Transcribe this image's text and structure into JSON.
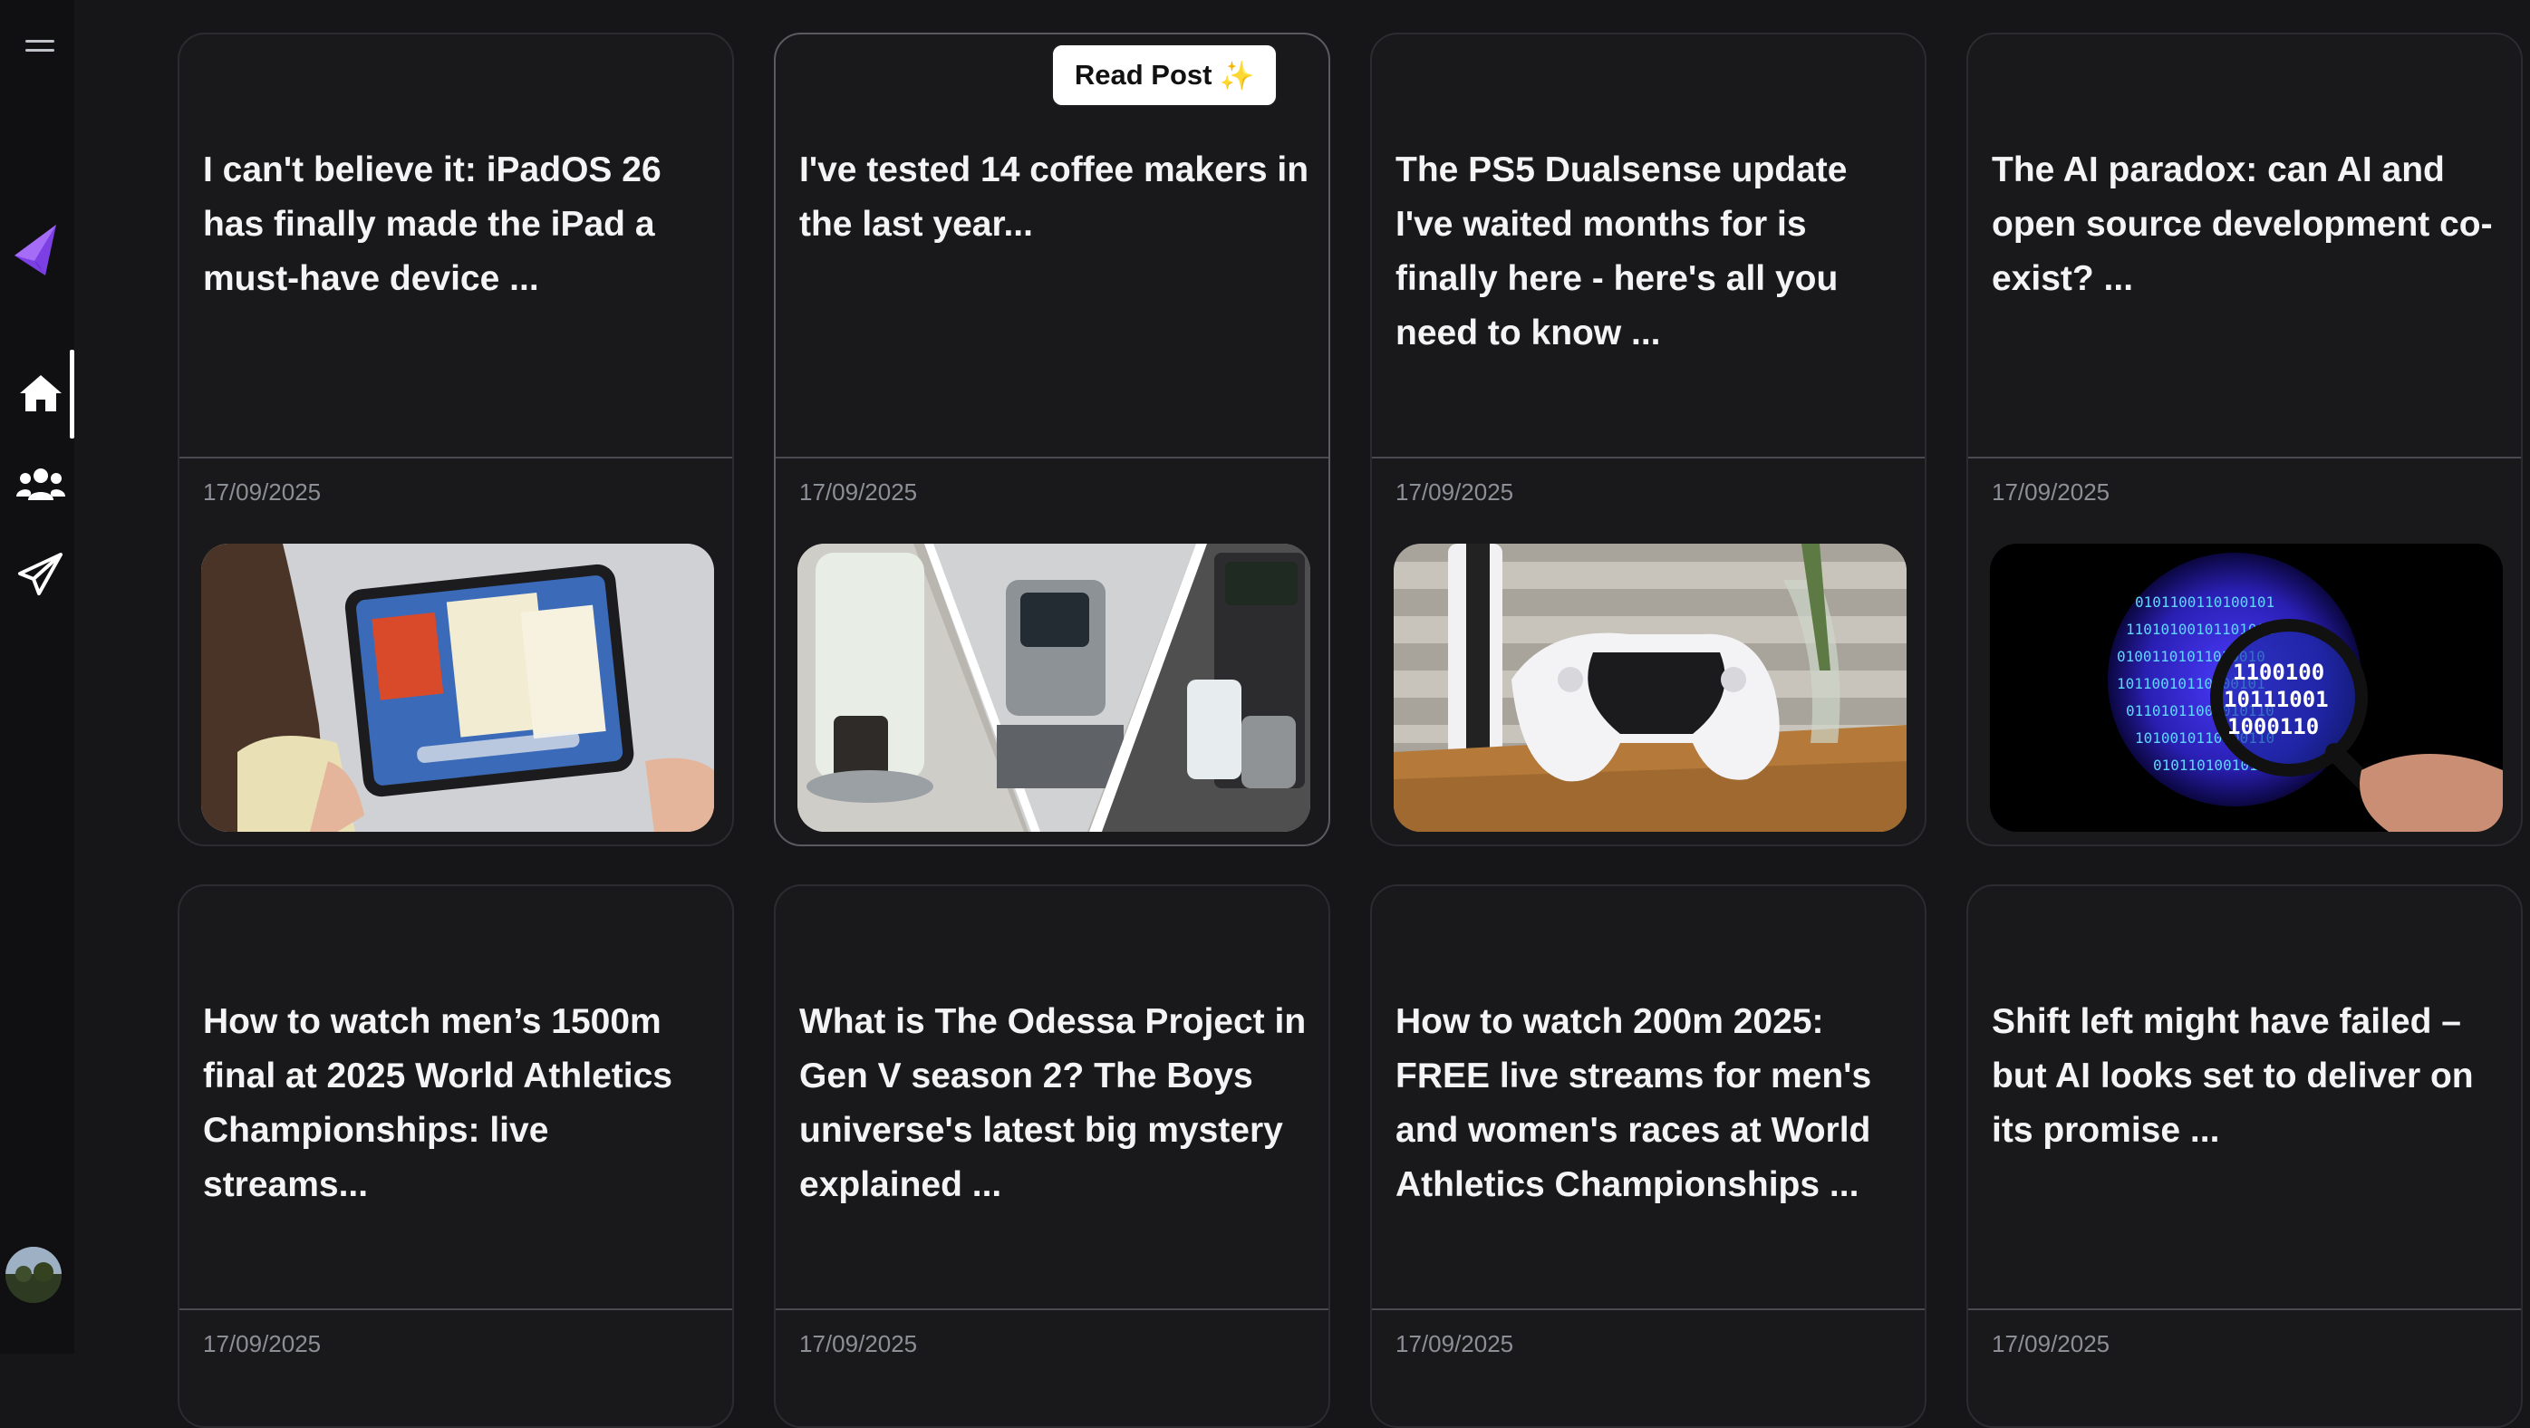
{
  "sidebar": {
    "menu_icon": "hamburger-icon",
    "logo_icon": "paper-plane-logo",
    "nav": [
      {
        "name": "home",
        "icon": "home-icon",
        "active": true
      },
      {
        "name": "friends",
        "icon": "users-icon",
        "active": false
      },
      {
        "name": "send",
        "icon": "paper-plane-icon",
        "active": false
      }
    ],
    "avatar_icon": "user-avatar"
  },
  "read_post_button": {
    "label": "Read Post",
    "emoji": "✨"
  },
  "posts": [
    {
      "title": "I can't believe it: iPadOS 26 has finally made the iPad a must-have device ...",
      "date": "17/09/2025",
      "image": "ipad-image"
    },
    {
      "title": "I've tested 14 coffee makers in the last year...",
      "date": "17/09/2025",
      "image": "coffee-makers-image"
    },
    {
      "title": "The PS5 Dualsense update I've waited months for is finally here - here's all you need to know ...",
      "date": "17/09/2025",
      "image": "ps5-controller-image"
    },
    {
      "title": "The AI paradox: can AI and open source development co-exist? ...",
      "date": "17/09/2025",
      "image": "binary-globe-image"
    },
    {
      "title": "How to watch men’s 1500m final at 2025 World Athletics Championships: live streams...",
      "date": "17/09/2025",
      "image": ""
    },
    {
      "title": "What is The Odessa Project in Gen V season 2? The Boys universe's latest big mystery explained ...",
      "date": "17/09/2025",
      "image": ""
    },
    {
      "title": "How to watch 200m 2025: FREE live streams for men's and women's races at World Athletics Championships ...",
      "date": "17/09/2025",
      "image": ""
    },
    {
      "title": "Shift left might have failed – but AI looks set to deliver on its promise ...",
      "date": "17/09/2025",
      "image": ""
    }
  ],
  "colors": {
    "background": "#161618",
    "card": "#19191b",
    "accent": "#7b3fe4"
  }
}
